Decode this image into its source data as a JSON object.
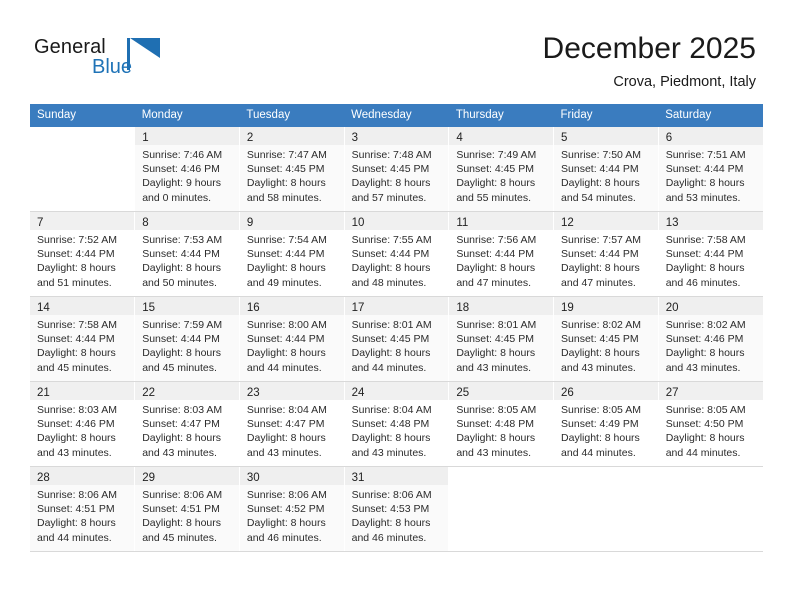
{
  "brand": {
    "name_part1": "General",
    "name_part2": "Blue",
    "logo_icon": "flag-triangle-icon"
  },
  "header": {
    "title": "December 2025",
    "location": "Crova, Piedmont, Italy"
  },
  "colors": {
    "header_blue": "#3a7cbf",
    "brand_blue": "#1f73b7",
    "daynum_bg": "#f0f0f0",
    "row_shade": "#fafafa",
    "grid_line": "#d9d9d9"
  },
  "weekdays": [
    "Sunday",
    "Monday",
    "Tuesday",
    "Wednesday",
    "Thursday",
    "Friday",
    "Saturday"
  ],
  "weeks": [
    [
      {
        "day": "",
        "lines": [
          "",
          "",
          "",
          ""
        ],
        "empty": true
      },
      {
        "day": "1",
        "lines": [
          "Sunrise: 7:46 AM",
          "Sunset: 4:46 PM",
          "Daylight: 9 hours",
          "and 0 minutes."
        ],
        "empty": false
      },
      {
        "day": "2",
        "lines": [
          "Sunrise: 7:47 AM",
          "Sunset: 4:45 PM",
          "Daylight: 8 hours",
          "and 58 minutes."
        ],
        "empty": false
      },
      {
        "day": "3",
        "lines": [
          "Sunrise: 7:48 AM",
          "Sunset: 4:45 PM",
          "Daylight: 8 hours",
          "and 57 minutes."
        ],
        "empty": false
      },
      {
        "day": "4",
        "lines": [
          "Sunrise: 7:49 AM",
          "Sunset: 4:45 PM",
          "Daylight: 8 hours",
          "and 55 minutes."
        ],
        "empty": false
      },
      {
        "day": "5",
        "lines": [
          "Sunrise: 7:50 AM",
          "Sunset: 4:44 PM",
          "Daylight: 8 hours",
          "and 54 minutes."
        ],
        "empty": false
      },
      {
        "day": "6",
        "lines": [
          "Sunrise: 7:51 AM",
          "Sunset: 4:44 PM",
          "Daylight: 8 hours",
          "and 53 minutes."
        ],
        "empty": false
      }
    ],
    [
      {
        "day": "7",
        "lines": [
          "Sunrise: 7:52 AM",
          "Sunset: 4:44 PM",
          "Daylight: 8 hours",
          "and 51 minutes."
        ],
        "empty": false
      },
      {
        "day": "8",
        "lines": [
          "Sunrise: 7:53 AM",
          "Sunset: 4:44 PM",
          "Daylight: 8 hours",
          "and 50 minutes."
        ],
        "empty": false
      },
      {
        "day": "9",
        "lines": [
          "Sunrise: 7:54 AM",
          "Sunset: 4:44 PM",
          "Daylight: 8 hours",
          "and 49 minutes."
        ],
        "empty": false
      },
      {
        "day": "10",
        "lines": [
          "Sunrise: 7:55 AM",
          "Sunset: 4:44 PM",
          "Daylight: 8 hours",
          "and 48 minutes."
        ],
        "empty": false
      },
      {
        "day": "11",
        "lines": [
          "Sunrise: 7:56 AM",
          "Sunset: 4:44 PM",
          "Daylight: 8 hours",
          "and 47 minutes."
        ],
        "empty": false
      },
      {
        "day": "12",
        "lines": [
          "Sunrise: 7:57 AM",
          "Sunset: 4:44 PM",
          "Daylight: 8 hours",
          "and 47 minutes."
        ],
        "empty": false
      },
      {
        "day": "13",
        "lines": [
          "Sunrise: 7:58 AM",
          "Sunset: 4:44 PM",
          "Daylight: 8 hours",
          "and 46 minutes."
        ],
        "empty": false
      }
    ],
    [
      {
        "day": "14",
        "lines": [
          "Sunrise: 7:58 AM",
          "Sunset: 4:44 PM",
          "Daylight: 8 hours",
          "and 45 minutes."
        ],
        "empty": false
      },
      {
        "day": "15",
        "lines": [
          "Sunrise: 7:59 AM",
          "Sunset: 4:44 PM",
          "Daylight: 8 hours",
          "and 45 minutes."
        ],
        "empty": false
      },
      {
        "day": "16",
        "lines": [
          "Sunrise: 8:00 AM",
          "Sunset: 4:44 PM",
          "Daylight: 8 hours",
          "and 44 minutes."
        ],
        "empty": false
      },
      {
        "day": "17",
        "lines": [
          "Sunrise: 8:01 AM",
          "Sunset: 4:45 PM",
          "Daylight: 8 hours",
          "and 44 minutes."
        ],
        "empty": false
      },
      {
        "day": "18",
        "lines": [
          "Sunrise: 8:01 AM",
          "Sunset: 4:45 PM",
          "Daylight: 8 hours",
          "and 43 minutes."
        ],
        "empty": false
      },
      {
        "day": "19",
        "lines": [
          "Sunrise: 8:02 AM",
          "Sunset: 4:45 PM",
          "Daylight: 8 hours",
          "and 43 minutes."
        ],
        "empty": false
      },
      {
        "day": "20",
        "lines": [
          "Sunrise: 8:02 AM",
          "Sunset: 4:46 PM",
          "Daylight: 8 hours",
          "and 43 minutes."
        ],
        "empty": false
      }
    ],
    [
      {
        "day": "21",
        "lines": [
          "Sunrise: 8:03 AM",
          "Sunset: 4:46 PM",
          "Daylight: 8 hours",
          "and 43 minutes."
        ],
        "empty": false
      },
      {
        "day": "22",
        "lines": [
          "Sunrise: 8:03 AM",
          "Sunset: 4:47 PM",
          "Daylight: 8 hours",
          "and 43 minutes."
        ],
        "empty": false
      },
      {
        "day": "23",
        "lines": [
          "Sunrise: 8:04 AM",
          "Sunset: 4:47 PM",
          "Daylight: 8 hours",
          "and 43 minutes."
        ],
        "empty": false
      },
      {
        "day": "24",
        "lines": [
          "Sunrise: 8:04 AM",
          "Sunset: 4:48 PM",
          "Daylight: 8 hours",
          "and 43 minutes."
        ],
        "empty": false
      },
      {
        "day": "25",
        "lines": [
          "Sunrise: 8:05 AM",
          "Sunset: 4:48 PM",
          "Daylight: 8 hours",
          "and 43 minutes."
        ],
        "empty": false
      },
      {
        "day": "26",
        "lines": [
          "Sunrise: 8:05 AM",
          "Sunset: 4:49 PM",
          "Daylight: 8 hours",
          "and 44 minutes."
        ],
        "empty": false
      },
      {
        "day": "27",
        "lines": [
          "Sunrise: 8:05 AM",
          "Sunset: 4:50 PM",
          "Daylight: 8 hours",
          "and 44 minutes."
        ],
        "empty": false
      }
    ],
    [
      {
        "day": "28",
        "lines": [
          "Sunrise: 8:06 AM",
          "Sunset: 4:51 PM",
          "Daylight: 8 hours",
          "and 44 minutes."
        ],
        "empty": false
      },
      {
        "day": "29",
        "lines": [
          "Sunrise: 8:06 AM",
          "Sunset: 4:51 PM",
          "Daylight: 8 hours",
          "and 45 minutes."
        ],
        "empty": false
      },
      {
        "day": "30",
        "lines": [
          "Sunrise: 8:06 AM",
          "Sunset: 4:52 PM",
          "Daylight: 8 hours",
          "and 46 minutes."
        ],
        "empty": false
      },
      {
        "day": "31",
        "lines": [
          "Sunrise: 8:06 AM",
          "Sunset: 4:53 PM",
          "Daylight: 8 hours",
          "and 46 minutes."
        ],
        "empty": false
      },
      {
        "day": "",
        "lines": [
          "",
          "",
          "",
          ""
        ],
        "empty": true
      },
      {
        "day": "",
        "lines": [
          "",
          "",
          "",
          ""
        ],
        "empty": true
      },
      {
        "day": "",
        "lines": [
          "",
          "",
          "",
          ""
        ],
        "empty": true
      }
    ]
  ]
}
